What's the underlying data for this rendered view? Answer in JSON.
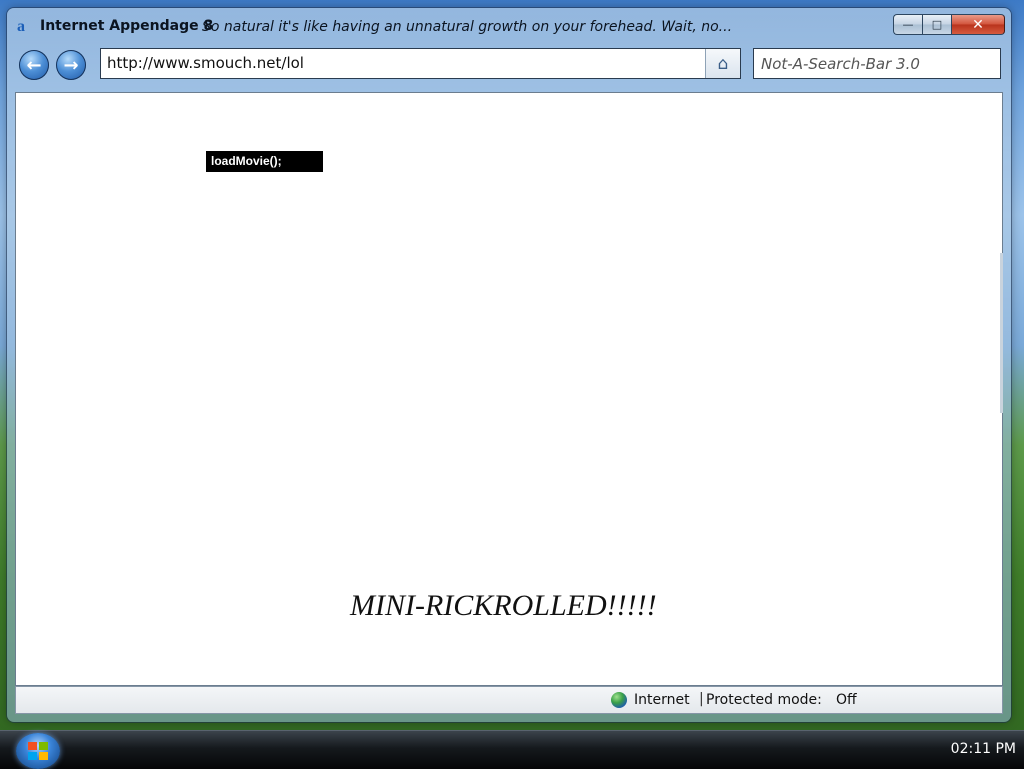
{
  "window": {
    "app_title": "Internet Appendage 8",
    "tagline": "So natural it's like having an unnatural growth on your forehead.  Wait, no...",
    "controls": {
      "minimize_icon": "minimize-icon",
      "maximize_icon": "maximize-icon",
      "close_icon": "close-icon"
    }
  },
  "toolbar": {
    "address": "http://www.smouch.net/lol",
    "search_placeholder": "Not-A-Search-Bar 3.0",
    "back_icon": "back-arrow-icon",
    "forward_icon": "forward-arrow-icon",
    "home_icon": "home-icon"
  },
  "content": {
    "flash_label": "loadMovie();",
    "message": "MINI-RICKROLLED!!!!!"
  },
  "statusbar": {
    "zone": "Internet",
    "separator": "|",
    "protected_mode_label": "Protected mode:",
    "protected_mode_value": "Off"
  },
  "taskbar": {
    "clock": "02:11 PM"
  }
}
